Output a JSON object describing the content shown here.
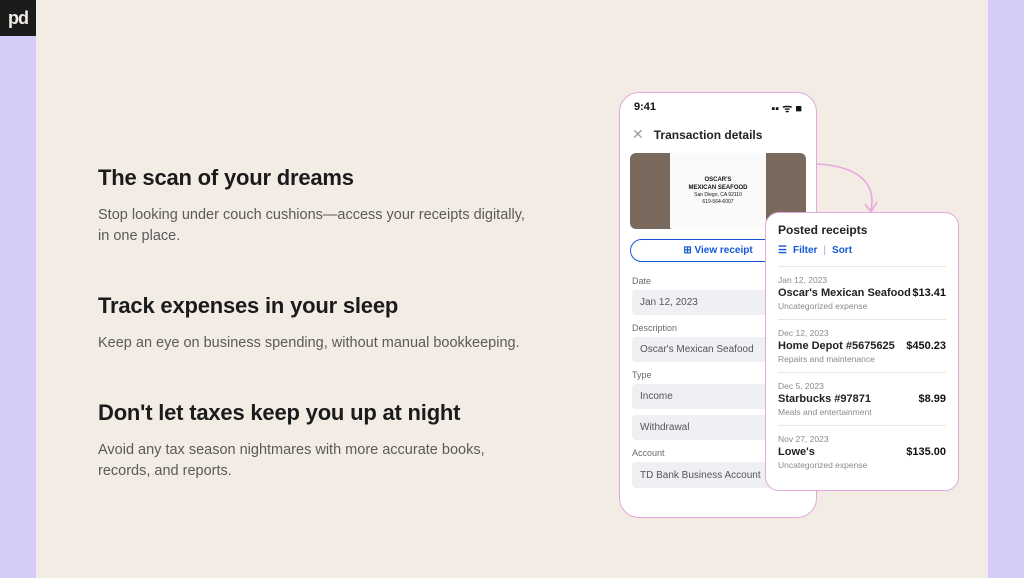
{
  "logo": "pd",
  "copy": {
    "sections": [
      {
        "heading": "The scan of your dreams",
        "body": "Stop looking under couch cushions—access your receipts digitally, in one place."
      },
      {
        "heading": "Track expenses in your sleep",
        "body": "Keep an eye on business spending, without manual bookkeeping."
      },
      {
        "heading": "Don't let taxes keep you up at night",
        "body": "Avoid any tax season nightmares with more accurate books, records, and reports."
      }
    ]
  },
  "phone": {
    "status_time": "9:41",
    "status_icons": "▪▪ ᯤ ■",
    "header_title": "Transaction details",
    "receipt_vendor_top": "OSCAR'S",
    "receipt_vendor_mid": "MEXICAN SEAFOOD",
    "receipt_vendor_sub1": "San Diego, CA 92110",
    "receipt_vendor_sub2": "619-564-6007",
    "view_receipt_label": "⊞  View receipt",
    "fields": {
      "date_label": "Date",
      "date_value": "Jan 12, 2023",
      "description_label": "Description",
      "description_value": "Oscar's Mexican Seafood",
      "type_label": "Type",
      "type_option_1": "Income",
      "type_option_2": "Withdrawal",
      "account_label": "Account",
      "account_value": "TD Bank Business Account"
    }
  },
  "receipts": {
    "title": "Posted receipts",
    "filter_label": "Filter",
    "sort_label": "Sort",
    "items": [
      {
        "date": "Jan 12, 2023",
        "name": "Oscar's Mexican Seafood",
        "amount": "$13.41",
        "category": "Uncategorized expense"
      },
      {
        "date": "Dec 12, 2023",
        "name": "Home Depot #5675625",
        "amount": "$450.23",
        "category": "Repairs and maintenance"
      },
      {
        "date": "Dec 5, 2023",
        "name": "Starbucks #97871",
        "amount": "$8.99",
        "category": "Meals and entertainment"
      },
      {
        "date": "Nov 27, 2023",
        "name": "Lowe's",
        "amount": "$135.00",
        "category": "Uncategorized expense"
      }
    ]
  }
}
